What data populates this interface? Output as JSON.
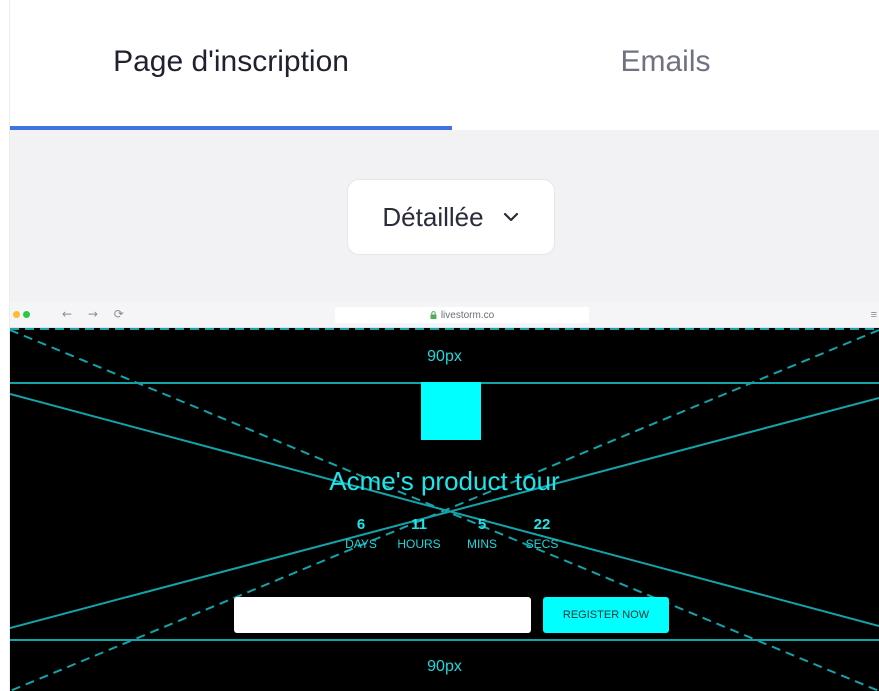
{
  "tabs": [
    {
      "label": "Page d'inscription",
      "active": true
    },
    {
      "label": "Emails",
      "active": false
    }
  ],
  "layout_select": {
    "value": "Détaillée",
    "icon": "chevron-down-icon"
  },
  "browser": {
    "url": "livestorm.co",
    "dot_colors": [
      "#ff5f57",
      "#febc2e",
      "#28c840"
    ],
    "nav_glyphs": "← → ⟳",
    "menu_glyph": "≡"
  },
  "preview": {
    "top_padding_label": "90px",
    "bottom_padding_label": "90px",
    "event_title": "Acme's product tour",
    "countdown": [
      {
        "value": "6",
        "label": "DAYS"
      },
      {
        "value": "11",
        "label": "HOURS"
      },
      {
        "value": "5",
        "label": "MINS"
      },
      {
        "value": "22",
        "label": "SECS"
      }
    ],
    "register_label": "REGISTER NOW",
    "email_placeholder": ""
  },
  "colors": {
    "accent": "#3f73e3",
    "guide": "#14a3a8",
    "cyan": "#00ffff",
    "preview_bg": "#000000"
  }
}
